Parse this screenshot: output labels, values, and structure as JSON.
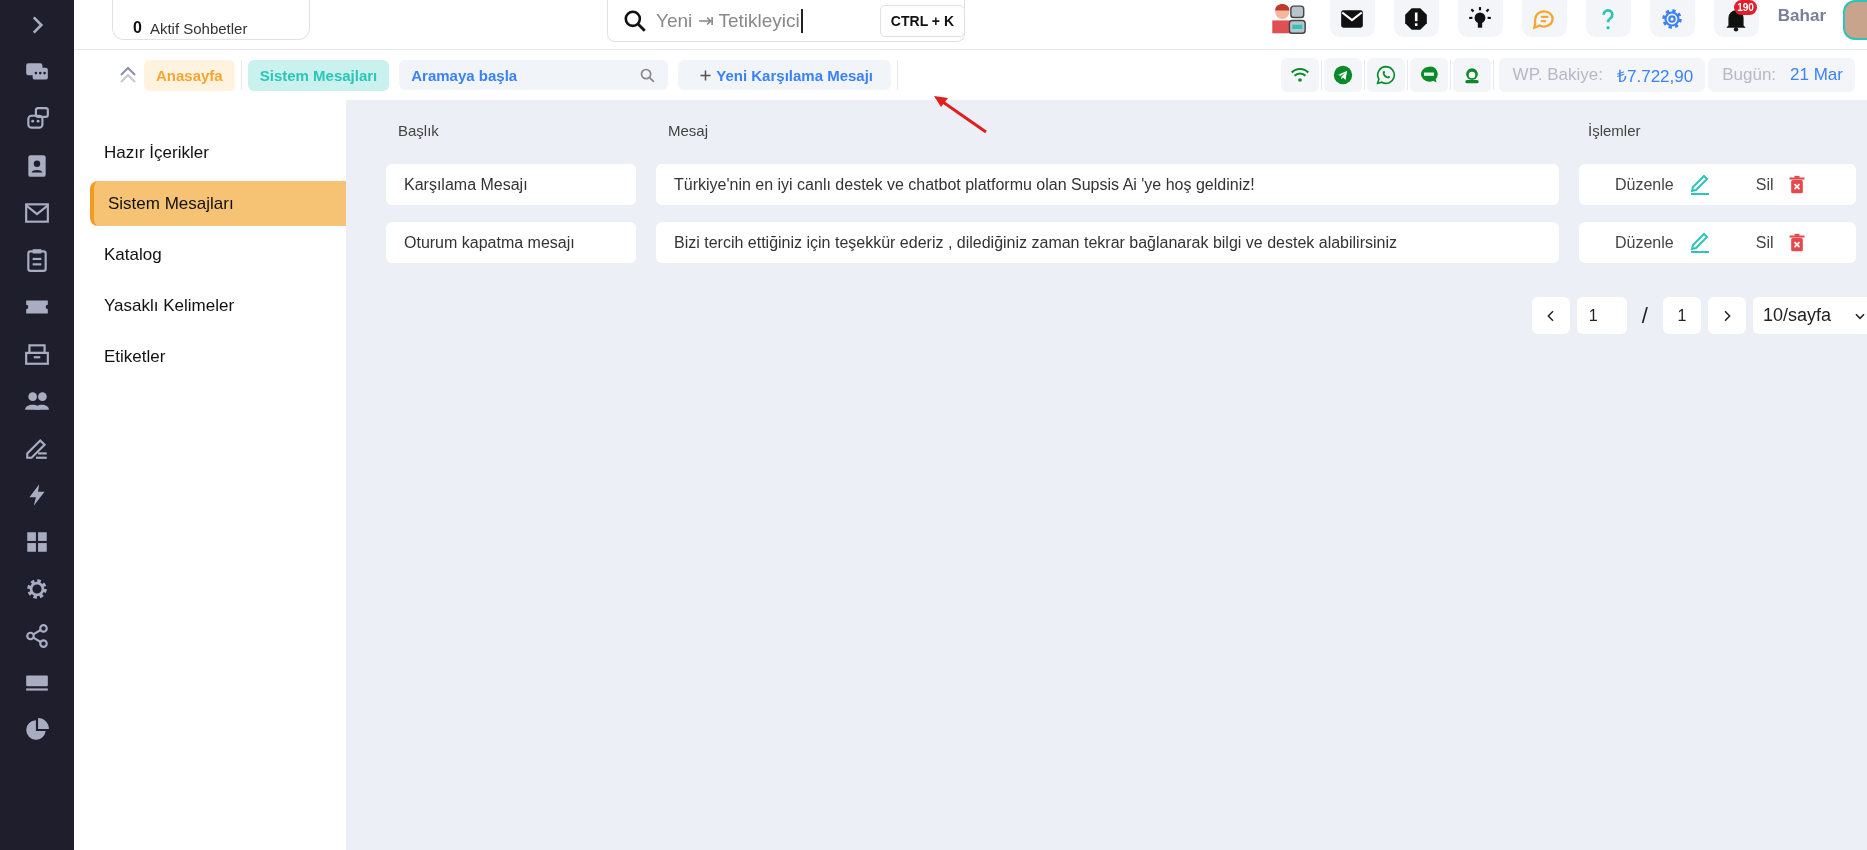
{
  "topbar": {
    "active_chats": {
      "count": "0",
      "label": "Aktif Sohbetler"
    },
    "search": {
      "value": "Yeni ⇥ Tetikleyici",
      "shortcut": "CTRL + K"
    },
    "notifications": {
      "count": "190"
    },
    "user": {
      "name": "Bahar"
    }
  },
  "toolbar": {
    "breadcrumbs": [
      {
        "label": "Anasayfa",
        "kind": "home"
      },
      {
        "label": "Sistem Mesajları",
        "kind": "current"
      }
    ],
    "search": {
      "placeholder": "Aramaya başla"
    },
    "new_button": {
      "label": "Yeni Karşılama Mesajı"
    },
    "balance": {
      "label": "WP. Bakiye:",
      "value": "₺7.722,90"
    },
    "date": {
      "label": "Bugün:",
      "value": "21 Mar"
    }
  },
  "menu": {
    "items": [
      {
        "label": "Hazır İçerikler",
        "selected": false
      },
      {
        "label": "Sistem Mesajları",
        "selected": true
      },
      {
        "label": "Katalog",
        "selected": false
      },
      {
        "label": "Yasaklı Kelimeler",
        "selected": false
      },
      {
        "label": "Etiketler",
        "selected": false
      }
    ]
  },
  "table": {
    "columns": [
      "Başlık",
      "Mesaj",
      "İşlemler"
    ],
    "rows": [
      {
        "title": "Karşılama Mesajı",
        "message": "Türkiye'nin en iyi canlı destek ve chatbot platformu olan Supsis Ai 'ye hoş geldiniz!",
        "edit": "Düzenle",
        "delete": "Sil"
      },
      {
        "title": "Oturum kapatma mesajı",
        "message": "Bizi tercih ettiğiniz için teşekkür ederiz , dilediğiniz zaman tekrar bağlanarak bilgi ve destek alabilirsiniz",
        "edit": "Düzenle",
        "delete": "Sil"
      }
    ]
  },
  "pagination": {
    "current": "1",
    "separator": "/",
    "total": "1",
    "page_size": "10/sayfa"
  }
}
